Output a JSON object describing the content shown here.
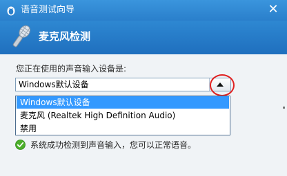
{
  "window": {
    "title": "语音测试向导",
    "close_label": "✕"
  },
  "header": {
    "title": "麦克风检测"
  },
  "device": {
    "label": "您正在使用的声音输入设备是:",
    "selected_value": "Windows默认设备",
    "options": [
      "Windows默认设备",
      "麦克风 (Realtek High Definition Audio)",
      "禁用"
    ],
    "selected_index": 0
  },
  "status": {
    "text": "系统成功检测到声音输入，您可以正常语音。"
  },
  "colors": {
    "titlebar": "#2a7fcb",
    "header": "#1f6fbe",
    "selection": "#3399ff",
    "highlight_circle": "#e02020",
    "success": "#4caf2a"
  },
  "icons": {
    "title": "penguin-icon",
    "header": "microphone-icon",
    "status": "check-circle-icon",
    "combo": "caret-up-icon"
  }
}
